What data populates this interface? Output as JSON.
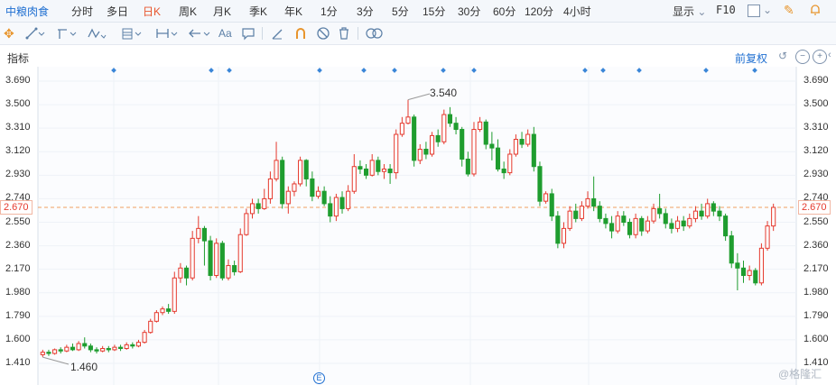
{
  "stock": {
    "name": "中粮肉食"
  },
  "periods": [
    "分时",
    "多日",
    "日K",
    "周K",
    "月K",
    "季K",
    "年K",
    "1分",
    "3分",
    "5分",
    "15分",
    "30分",
    "60分",
    "120分",
    "4小时"
  ],
  "active_period": "日K",
  "right_toolbar": {
    "display_label": "显示",
    "f10_label": "F10"
  },
  "sub": {
    "indicator_label": "指标",
    "adjust_label": "前复权"
  },
  "toolbar2": {
    "text_tool": "Aa"
  },
  "y_axis": {
    "ticks": [
      "3.690",
      "3.500",
      "3.310",
      "3.120",
      "2.930",
      "2.740",
      "2.550",
      "2.360",
      "2.170",
      "1.980",
      "1.790",
      "1.600",
      "1.410"
    ]
  },
  "current_price": "2.670",
  "annotations": {
    "high": "3.540",
    "low": "1.460"
  },
  "event_marker": "E",
  "watermark": "@格隆汇",
  "colors": {
    "up": "#e5392d",
    "down": "#1f9d2f",
    "accent": "#1f6fd1",
    "active": "#e8552d",
    "dash": "#f0a060"
  },
  "chart_data": {
    "type": "candlestick",
    "ylim": [
      1.41,
      3.69
    ],
    "current": 2.67,
    "high_label": 3.54,
    "low_label": 1.46,
    "candles": [
      [
        1.48,
        1.5,
        1.52,
        1.46
      ],
      [
        1.5,
        1.49,
        1.52,
        1.47
      ],
      [
        1.49,
        1.52,
        1.53,
        1.48
      ],
      [
        1.52,
        1.51,
        1.54,
        1.49
      ],
      [
        1.51,
        1.54,
        1.56,
        1.5
      ],
      [
        1.54,
        1.52,
        1.57,
        1.51
      ],
      [
        1.52,
        1.57,
        1.59,
        1.51
      ],
      [
        1.57,
        1.55,
        1.62,
        1.53
      ],
      [
        1.55,
        1.52,
        1.57,
        1.5
      ],
      [
        1.52,
        1.51,
        1.54,
        1.49
      ],
      [
        1.51,
        1.53,
        1.55,
        1.5
      ],
      [
        1.53,
        1.52,
        1.55,
        1.5
      ],
      [
        1.52,
        1.54,
        1.56,
        1.51
      ],
      [
        1.54,
        1.53,
        1.56,
        1.51
      ],
      [
        1.53,
        1.56,
        1.58,
        1.52
      ],
      [
        1.56,
        1.55,
        1.58,
        1.53
      ],
      [
        1.55,
        1.58,
        1.6,
        1.54
      ],
      [
        1.58,
        1.66,
        1.68,
        1.57
      ],
      [
        1.66,
        1.75,
        1.77,
        1.65
      ],
      [
        1.75,
        1.82,
        1.84,
        1.74
      ],
      [
        1.82,
        1.85,
        1.87,
        1.8
      ],
      [
        1.85,
        1.83,
        1.89,
        1.81
      ],
      [
        1.83,
        2.1,
        2.15,
        1.81
      ],
      [
        2.1,
        2.18,
        2.22,
        2.06
      ],
      [
        2.18,
        2.1,
        2.2,
        2.04
      ],
      [
        2.1,
        2.42,
        2.48,
        2.08
      ],
      [
        2.42,
        2.5,
        2.6,
        2.38
      ],
      [
        2.5,
        2.4,
        2.52,
        2.2
      ],
      [
        2.4,
        2.12,
        2.44,
        2.08
      ],
      [
        2.12,
        2.38,
        2.42,
        2.1
      ],
      [
        2.38,
        2.1,
        2.4,
        2.08
      ],
      [
        2.1,
        2.2,
        2.25,
        2.08
      ],
      [
        2.2,
        2.15,
        2.24,
        2.12
      ],
      [
        2.15,
        2.45,
        2.5,
        2.14
      ],
      [
        2.45,
        2.62,
        2.66,
        2.44
      ],
      [
        2.62,
        2.7,
        2.74,
        2.58
      ],
      [
        2.7,
        2.66,
        2.74,
        2.62
      ],
      [
        2.66,
        2.74,
        2.82,
        2.65
      ],
      [
        2.74,
        2.9,
        2.96,
        2.7
      ],
      [
        2.9,
        3.05,
        3.2,
        2.88
      ],
      [
        3.05,
        2.7,
        3.08,
        2.66
      ],
      [
        2.7,
        2.8,
        2.84,
        2.62
      ],
      [
        2.8,
        2.86,
        2.88,
        2.76
      ],
      [
        2.86,
        3.05,
        3.08,
        2.84
      ],
      [
        3.05,
        2.9,
        3.06,
        2.84
      ],
      [
        2.9,
        2.76,
        2.96,
        2.72
      ],
      [
        2.76,
        2.8,
        2.84,
        2.74
      ],
      [
        2.8,
        2.7,
        2.84,
        2.68
      ],
      [
        2.7,
        2.6,
        2.76,
        2.55
      ],
      [
        2.6,
        2.75,
        2.78,
        2.56
      ],
      [
        2.75,
        2.66,
        2.8,
        2.62
      ],
      [
        2.66,
        2.8,
        2.85,
        2.64
      ],
      [
        2.8,
        3.0,
        3.1,
        2.78
      ],
      [
        3.0,
        2.98,
        3.05,
        2.94
      ],
      [
        2.98,
        2.93,
        3.02,
        2.9
      ],
      [
        2.93,
        3.05,
        3.1,
        2.92
      ],
      [
        3.05,
        2.96,
        3.08,
        2.93
      ],
      [
        2.96,
        2.98,
        3.02,
        2.9
      ],
      [
        2.98,
        2.95,
        3.02,
        2.86
      ],
      [
        2.95,
        3.26,
        3.3,
        2.9
      ],
      [
        3.26,
        3.35,
        3.4,
        3.24
      ],
      [
        3.35,
        3.4,
        3.54,
        3.34
      ],
      [
        3.4,
        3.05,
        3.42,
        3.0
      ],
      [
        3.05,
        3.14,
        3.18,
        3.02
      ],
      [
        3.14,
        3.1,
        3.2,
        3.06
      ],
      [
        3.1,
        3.25,
        3.28,
        3.08
      ],
      [
        3.25,
        3.2,
        3.3,
        3.16
      ],
      [
        3.2,
        3.42,
        3.46,
        3.18
      ],
      [
        3.42,
        3.35,
        3.48,
        3.32
      ],
      [
        3.35,
        3.3,
        3.4,
        3.26
      ],
      [
        3.3,
        3.06,
        3.32,
        3.0
      ],
      [
        3.06,
        2.94,
        3.12,
        2.92
      ],
      [
        2.94,
        3.3,
        3.36,
        2.92
      ],
      [
        3.3,
        3.36,
        3.4,
        3.28
      ],
      [
        3.36,
        3.18,
        3.38,
        3.14
      ],
      [
        3.18,
        3.15,
        3.28,
        3.05
      ],
      [
        3.15,
        2.98,
        3.22,
        2.96
      ],
      [
        2.98,
        2.95,
        3.04,
        2.9
      ],
      [
        2.95,
        3.1,
        3.14,
        2.93
      ],
      [
        3.1,
        3.22,
        3.26,
        3.08
      ],
      [
        3.22,
        3.18,
        3.28,
        3.15
      ],
      [
        3.18,
        3.26,
        3.3,
        3.16
      ],
      [
        3.26,
        3.0,
        3.32,
        2.96
      ],
      [
        3.0,
        2.72,
        3.04,
        2.68
      ],
      [
        2.72,
        2.78,
        2.8,
        2.7
      ],
      [
        2.78,
        2.6,
        2.82,
        2.56
      ],
      [
        2.6,
        2.38,
        2.64,
        2.34
      ],
      [
        2.38,
        2.5,
        2.55,
        2.34
      ],
      [
        2.5,
        2.64,
        2.68,
        2.48
      ],
      [
        2.64,
        2.58,
        2.7,
        2.55
      ],
      [
        2.58,
        2.68,
        2.72,
        2.56
      ],
      [
        2.68,
        2.74,
        2.8,
        2.66
      ],
      [
        2.74,
        2.68,
        2.92,
        2.64
      ],
      [
        2.68,
        2.58,
        2.72,
        2.55
      ],
      [
        2.58,
        2.54,
        2.62,
        2.5
      ],
      [
        2.54,
        2.48,
        2.6,
        2.42
      ],
      [
        2.48,
        2.6,
        2.64,
        2.46
      ],
      [
        2.6,
        2.55,
        2.64,
        2.52
      ],
      [
        2.55,
        2.45,
        2.58,
        2.42
      ],
      [
        2.45,
        2.58,
        2.62,
        2.42
      ],
      [
        2.58,
        2.48,
        2.6,
        2.44
      ],
      [
        2.48,
        2.56,
        2.6,
        2.46
      ],
      [
        2.56,
        2.66,
        2.7,
        2.54
      ],
      [
        2.66,
        2.62,
        2.78,
        2.58
      ],
      [
        2.62,
        2.54,
        2.66,
        2.5
      ],
      [
        2.54,
        2.5,
        2.58,
        2.46
      ],
      [
        2.5,
        2.56,
        2.6,
        2.47
      ],
      [
        2.56,
        2.52,
        2.6,
        2.48
      ],
      [
        2.52,
        2.58,
        2.62,
        2.5
      ],
      [
        2.58,
        2.64,
        2.68,
        2.55
      ],
      [
        2.64,
        2.6,
        2.7,
        2.57
      ],
      [
        2.6,
        2.7,
        2.74,
        2.58
      ],
      [
        2.7,
        2.64,
        2.72,
        2.6
      ],
      [
        2.64,
        2.6,
        2.68,
        2.56
      ],
      [
        2.6,
        2.44,
        2.62,
        2.4
      ],
      [
        2.44,
        2.22,
        2.48,
        2.18
      ],
      [
        2.22,
        2.18,
        2.3,
        2.0
      ],
      [
        2.18,
        2.12,
        2.24,
        2.06
      ],
      [
        2.12,
        2.16,
        2.2,
        2.08
      ],
      [
        2.16,
        2.06,
        2.18,
        2.04
      ],
      [
        2.06,
        2.34,
        2.38,
        2.04
      ],
      [
        2.34,
        2.52,
        2.56,
        2.32
      ],
      [
        2.52,
        2.67,
        2.7,
        2.48
      ]
    ]
  }
}
